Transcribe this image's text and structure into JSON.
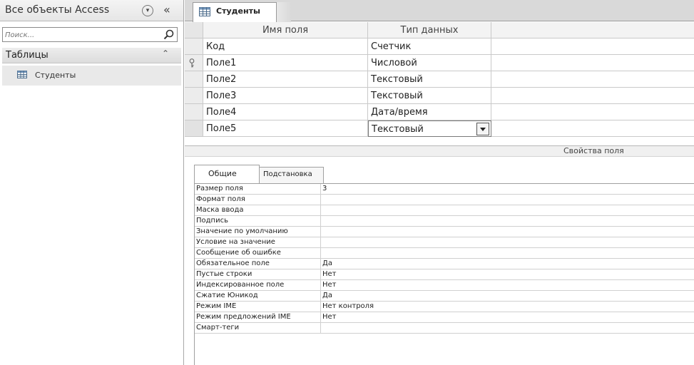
{
  "nav": {
    "title": "Все объекты Access",
    "search_placeholder": "Поиск...",
    "group_title": "Таблицы",
    "items": [
      {
        "label": "Студенты",
        "icon": "table-icon"
      }
    ]
  },
  "tab": {
    "label": "Студенты",
    "icon": "table-icon"
  },
  "grid": {
    "headers": {
      "field_name": "Имя поля",
      "data_type": "Тип данных"
    },
    "rows": [
      {
        "name": "Код",
        "type": "Счетчик"
      },
      {
        "name": "Поле1",
        "type": "Числовой",
        "primary_key": true
      },
      {
        "name": "Поле2",
        "type": "Текстовый"
      },
      {
        "name": "Поле3",
        "type": "Текстовый"
      },
      {
        "name": "Поле4",
        "type": "Дата/время"
      },
      {
        "name": "Поле5",
        "type": "Текстовый",
        "selected": true
      }
    ]
  },
  "properties": {
    "title": "Свойства поля",
    "tabs": [
      "Общие",
      "Подстановка"
    ],
    "rows": [
      {
        "name": "Размер поля",
        "value": "3"
      },
      {
        "name": "Формат поля",
        "value": ""
      },
      {
        "name": "Маска ввода",
        "value": ""
      },
      {
        "name": "Подпись",
        "value": ""
      },
      {
        "name": "Значение по умолчанию",
        "value": ""
      },
      {
        "name": "Условие на значение",
        "value": ""
      },
      {
        "name": "Сообщение об ошибке",
        "value": ""
      },
      {
        "name": "Обязательное поле",
        "value": "Да"
      },
      {
        "name": "Пустые строки",
        "value": "Нет"
      },
      {
        "name": "Индексированное поле",
        "value": "Нет"
      },
      {
        "name": "Сжатие Юникод",
        "value": "Да"
      },
      {
        "name": "Режим IME",
        "value": "Нет контроля"
      },
      {
        "name": "Режим предложений IME",
        "value": "Нет"
      },
      {
        "name": "Смарт-теги",
        "value": ""
      }
    ]
  }
}
